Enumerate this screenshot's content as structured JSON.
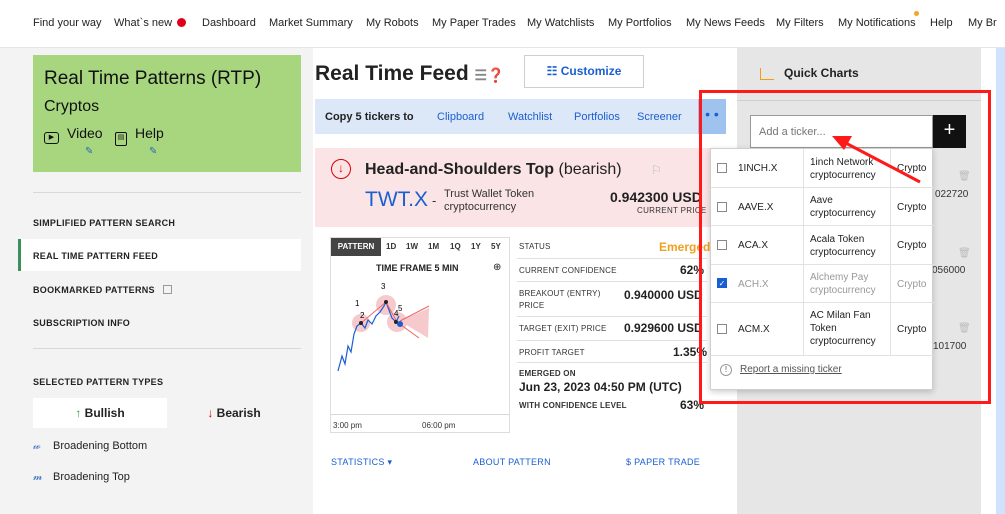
{
  "nav": {
    "items": [
      "Find your way",
      "What`s new",
      "Dashboard",
      "Market Summary",
      "My Robots",
      "My Paper Trades",
      "My Watchlists",
      "My Portfolios",
      "My News Feeds",
      "My Filters",
      "My Notifications",
      "Help",
      "My Br"
    ]
  },
  "sidebar": {
    "rtp_title": "Real Time Patterns (RTP)",
    "rtp_sub": "Cryptos",
    "video": "Video",
    "help": "Help",
    "menu": {
      "simplified": "SIMPLIFIED PATTERN SEARCH",
      "feed": "REAL TIME PATTERN FEED",
      "bookmarked": "BOOKMARKED PATTERNS",
      "subscription": "SUBSCRIPTION INFO"
    },
    "selected_types": "SELECTED PATTERN TYPES",
    "bullish": "Bullish",
    "bearish": "Bearish",
    "types": [
      "Broadening Bottom",
      "Broadening Top"
    ]
  },
  "main": {
    "title": "Real Time Feed",
    "customize": "Customize",
    "copy_label": "Copy 5 tickers to",
    "copy_targets": [
      "Clipboard",
      "Watchlist",
      "Portfolios",
      "Screener"
    ],
    "dots": "• •",
    "pattern_name": "Head-and-Shoulders Top",
    "pattern_dir": "(bearish)",
    "ticker": "TWT.X",
    "ticker_sep": "-",
    "ticker_name": "Trust Wallet Token",
    "ticker_type": "cryptocurrency",
    "price": "0.942300 USD",
    "price_label": "CURRENT PRICE",
    "timeframes": [
      "PATTERN",
      "1D",
      "1W",
      "1M",
      "1Q",
      "1Y",
      "5Y"
    ],
    "timeframe_label": "TIME FRAME 5 MIN",
    "zoom": "⊕",
    "axis_times": [
      "3:00 pm",
      "06:00 pm"
    ],
    "chart_points": [
      "1",
      "2",
      "3",
      "4",
      "5"
    ],
    "status_label": "STATUS",
    "status_value": "Emerged",
    "status_color": "#f0a020",
    "confidence_label": "CURRENT CONFIDENCE",
    "confidence_value": "62%",
    "breakout_label_1": "BREAKOUT (ENTRY)",
    "breakout_label_2": "PRICE",
    "breakout_value": "0.940000 USD",
    "target_label": "TARGET (EXIT) PRICE",
    "target_value": "0.929600 USD",
    "profit_label": "PROFIT TARGET",
    "profit_value": "1.35%",
    "emerged_label": "EMERGED ON",
    "emerged_value": "Jun 23, 2023 04:50 PM (UTC)",
    "level_label": "WITH CONFIDENCE LEVEL",
    "level_value": "63%",
    "statistics": "STATISTICS",
    "about": "ABOUT PATTERN",
    "paper_trade": "PAPER TRADE"
  },
  "quick_charts": {
    "title": "Quick Charts",
    "placeholder": "Add a ticker...",
    "plus": "+",
    "bg_values": [
      "022720",
      "056000",
      "101700"
    ],
    "report": "Report a missing ticker",
    "rows": [
      {
        "symbol": "1INCH.X",
        "name": "1inch Network cryptocurrency",
        "type": "Crypto",
        "checked": false
      },
      {
        "symbol": "AAVE.X",
        "name": "Aave cryptocurrency",
        "type": "Crypto",
        "checked": false
      },
      {
        "symbol": "ACA.X",
        "name": "Acala Token cryptocurrency",
        "type": "Crypto",
        "checked": false
      },
      {
        "symbol": "ACH.X",
        "name": "Alchemy Pay cryptocurrency",
        "type": "Crypto",
        "checked": true
      },
      {
        "symbol": "ACM.X",
        "name": "AC Milan Fan Token cryptocurrency",
        "type": "Crypto",
        "checked": false
      }
    ]
  },
  "colors": {
    "accent": "#1a5fd1",
    "rtp_green": "#a8d67f",
    "bearish_red": "#d00000",
    "highlight_red": "#ff1a1a"
  }
}
